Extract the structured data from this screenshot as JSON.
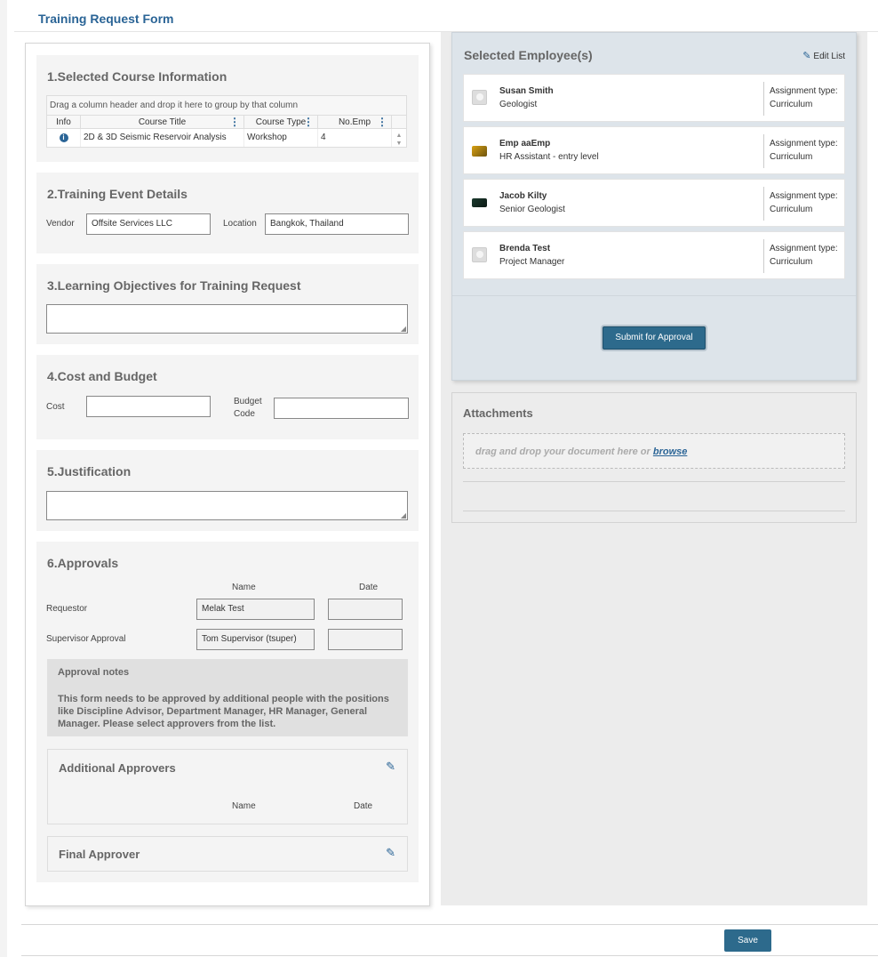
{
  "page": {
    "title": "Training Request Form"
  },
  "sections": {
    "course": {
      "title": "1.Selected Course Information",
      "group_hint": "Drag a column header and drop it here to group by that column",
      "columns": [
        "Info",
        "Course Title",
        "Course Type",
        "No.Emp"
      ],
      "rows": [
        {
          "course_title": "2D & 3D Seismic Reservoir Analysis",
          "course_type": "Workshop",
          "no_emp": "4"
        }
      ]
    },
    "event": {
      "title": "2.Training Event Details",
      "vendor_label": "Vendor",
      "vendor_value": "Offsite Services LLC",
      "location_label": "Location",
      "location_value": "Bangkok, Thailand"
    },
    "objectives": {
      "title": "3.Learning Objectives for Training Request"
    },
    "cost": {
      "title": "4.Cost and Budget",
      "cost_label": "Cost",
      "budget_label_1": "Budget",
      "budget_label_2": "Code"
    },
    "justification": {
      "title": "5.Justification"
    },
    "approvals": {
      "title": "6.Approvals",
      "col_name": "Name",
      "col_date": "Date",
      "requestor_label": "Requestor",
      "requestor_name": "Melak Test",
      "supervisor_label": "Supervisor Approval",
      "supervisor_name": "Tom Supervisor (tsuper)",
      "notes_title": "Approval notes",
      "notes_body": "This form needs to be approved by additional people with the positions like Discipline Advisor, Department Manager, HR Manager, General Manager. Please select approvers from the list.",
      "additional_title": "Additional Approvers",
      "additional_col_name": "Name",
      "additional_col_date": "Date",
      "final_title": "Final Approver"
    }
  },
  "employees": {
    "title": "Selected Employee(s)",
    "edit_label": "Edit List",
    "items": [
      {
        "name": "Susan Smith",
        "role": "Geologist",
        "assignment_label": "Assignment type:",
        "assignment_value": "Curriculum",
        "photo": "placeholder-avatar"
      },
      {
        "name": "Emp aaEmp",
        "role": "HR Assistant - entry level",
        "assignment_label": "Assignment type:",
        "assignment_value": "Curriculum",
        "photo": "flower-photo"
      },
      {
        "name": "Jacob Kilty",
        "role": "Senior Geologist",
        "assignment_label": "Assignment type:",
        "assignment_value": "Curriculum",
        "photo": "dark-photo"
      },
      {
        "name": "Brenda Test",
        "role": "Project Manager",
        "assignment_label": "Assignment type:",
        "assignment_value": "Curriculum",
        "photo": "placeholder-avatar"
      }
    ],
    "submit_label": "Submit for Approval"
  },
  "attachments": {
    "title": "Attachments",
    "drop_text": "drag and drop your document here or ",
    "browse_label": "browse"
  },
  "footer": {
    "save_label": "Save"
  },
  "colors": {
    "accent": "#2a6496",
    "button": "#2d6a8c",
    "panel": "#dde4ea"
  }
}
